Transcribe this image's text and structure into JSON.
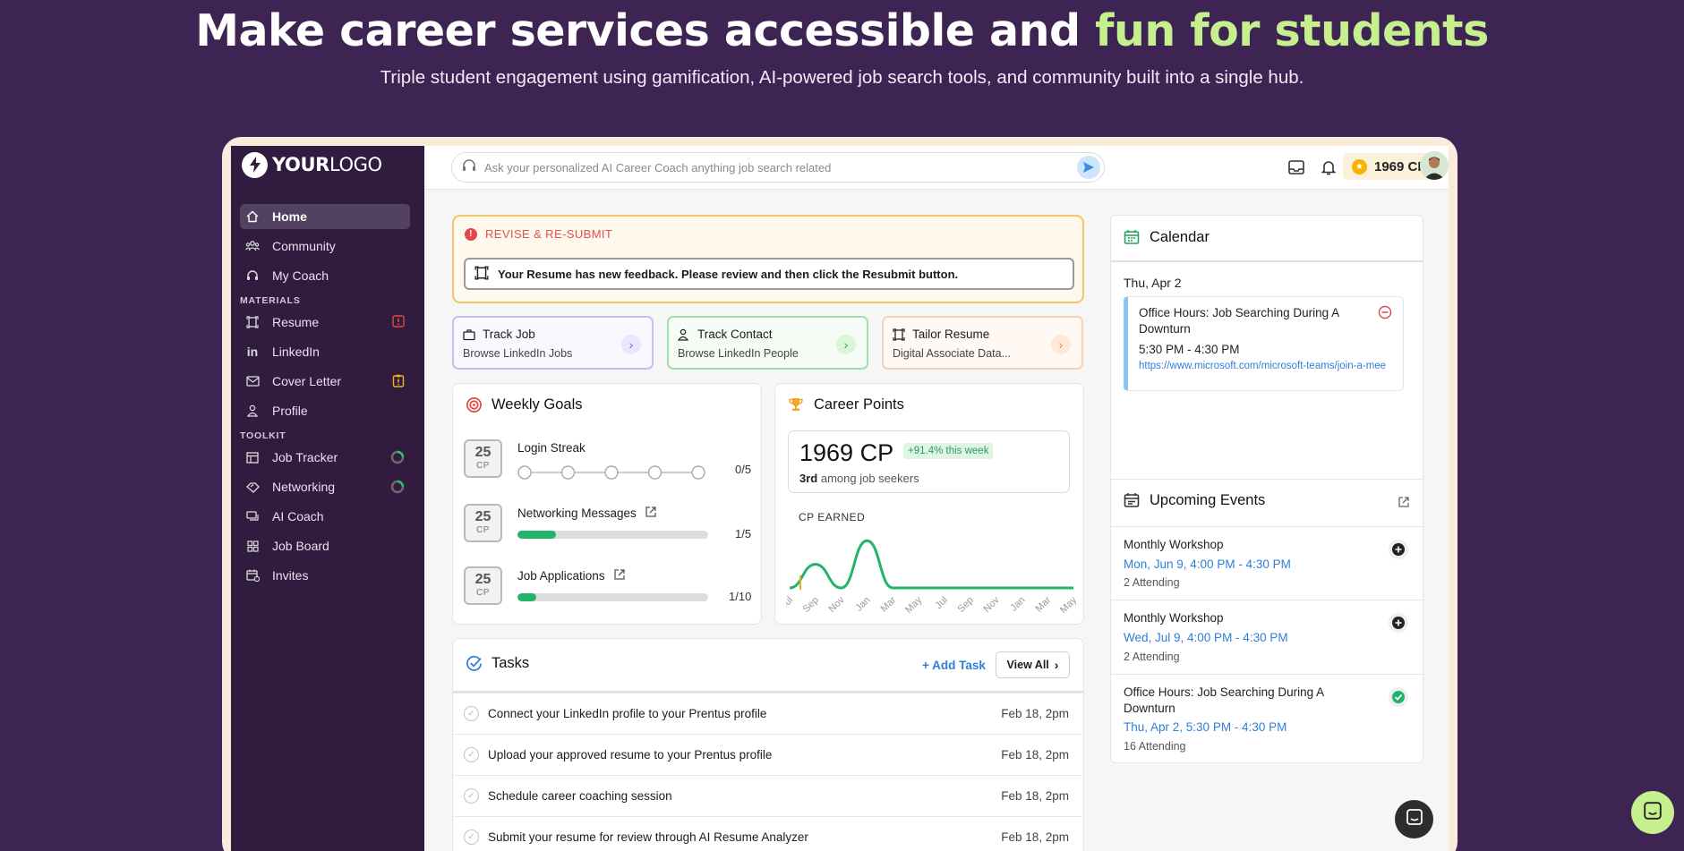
{
  "hero": {
    "title_main": "Make career services accessible and ",
    "title_accent": "fun for students",
    "subtitle": "Triple student engagement using gamification, AI-powered job search tools, and community built into a single hub."
  },
  "colors": {
    "background": "#3d2452",
    "accent": "#c6f08e",
    "sidebar": "#311c40",
    "link": "#2e7fd8",
    "success": "#22b46a"
  },
  "logo": {
    "bold": "YOUR",
    "light": "LOGO"
  },
  "sidebar": {
    "items": [
      {
        "label": "Home",
        "icon": "home-icon"
      },
      {
        "label": "Community",
        "icon": "community-icon"
      },
      {
        "label": "My Coach",
        "icon": "coach-icon"
      }
    ],
    "materials_header": "MATERIALS",
    "materials": [
      {
        "label": "Resume",
        "icon": "resume-icon"
      },
      {
        "label": "LinkedIn",
        "icon": "linkedin-icon"
      },
      {
        "label": "Cover Letter",
        "icon": "mail-icon"
      },
      {
        "label": "Profile",
        "icon": "user-icon"
      }
    ],
    "toolkit_header": "TOOLKIT",
    "toolkit": [
      {
        "label": "Job Tracker",
        "icon": "table-icon"
      },
      {
        "label": "Networking",
        "icon": "handshake-icon"
      },
      {
        "label": "AI Coach",
        "icon": "chat-icon"
      },
      {
        "label": "Job Board",
        "icon": "grid-icon"
      },
      {
        "label": "Invites",
        "icon": "calendar-plus-icon"
      }
    ]
  },
  "topbar": {
    "search_placeholder": "Ask your personalized AI Career Coach anything job search related",
    "points": "1969 CP"
  },
  "alert": {
    "title": "REVISE & RE-SUBMIT",
    "message": "Your Resume has new feedback. Please review and then click the Resubmit button."
  },
  "quick_actions": [
    {
      "title": "Track Job",
      "subtitle": "Browse LinkedIn Jobs"
    },
    {
      "title": "Track Contact",
      "subtitle": "Browse LinkedIn People"
    },
    {
      "title": "Tailor Resume",
      "subtitle": "Digital Associate Data..."
    }
  ],
  "weekly_goals": {
    "title": "Weekly Goals",
    "goals": [
      {
        "cp": "25",
        "unit": "CP",
        "name": "Login Streak",
        "value": "0/5",
        "progress": 0
      },
      {
        "cp": "25",
        "unit": "CP",
        "name": "Networking Messages",
        "value": "1/5",
        "progress": 0.2
      },
      {
        "cp": "25",
        "unit": "CP",
        "name": "Job Applications",
        "value": "1/10",
        "progress": 0.1
      }
    ]
  },
  "career_points": {
    "title": "Career Points",
    "total": "1969 CP",
    "change": "+91.4% this week",
    "rank_bold": "3rd",
    "rank_text": " among job seekers",
    "chart_label": "CP EARNED"
  },
  "chart_data": {
    "type": "line",
    "x": [
      "Jul",
      "Sep",
      "Nov",
      "Jan",
      "Mar",
      "May",
      "Jul",
      "Sep",
      "Nov",
      "Jan",
      "Mar",
      "May"
    ],
    "series": [
      {
        "values": [
          0,
          22,
          0,
          44,
          0,
          0,
          0,
          0,
          0,
          0,
          0,
          0
        ]
      }
    ]
  },
  "tasks": {
    "title": "Tasks",
    "add_label": "+ Add Task",
    "view_label": "View All",
    "items": [
      {
        "text": "Connect your LinkedIn profile to your Prentus profile",
        "date": "Feb 18, 2pm"
      },
      {
        "text": "Upload your approved resume to your Prentus profile",
        "date": "Feb 18, 2pm"
      },
      {
        "text": "Schedule career coaching session",
        "date": "Feb 18, 2pm"
      },
      {
        "text": "Submit your resume for review through AI Resume Analyzer",
        "date": "Feb 18, 2pm"
      }
    ]
  },
  "calendar": {
    "title": "Calendar",
    "date": "Thu, Apr 2",
    "event": {
      "title": "Office Hours: Job Searching During A Downturn",
      "time": "5:30 PM - 4:30 PM",
      "link": "https://www.microsoft.com/microsoft-teams/join-a-mee"
    }
  },
  "upcoming": {
    "title": "Upcoming Events",
    "events": [
      {
        "title": "Monthly Workshop",
        "date": "Mon, Jun 9, 4:00 PM - 4:30 PM",
        "attending": "2 Attending",
        "status": "add"
      },
      {
        "title": "Monthly Workshop",
        "date": "Wed, Jul 9, 4:00 PM - 4:30 PM",
        "attending": "2 Attending",
        "status": "add"
      },
      {
        "title": "Office Hours: Job Searching During A Downturn",
        "date": "Thu, Apr 2, 5:30 PM - 4:30 PM",
        "attending": "16 Attending",
        "status": "joined"
      }
    ]
  }
}
